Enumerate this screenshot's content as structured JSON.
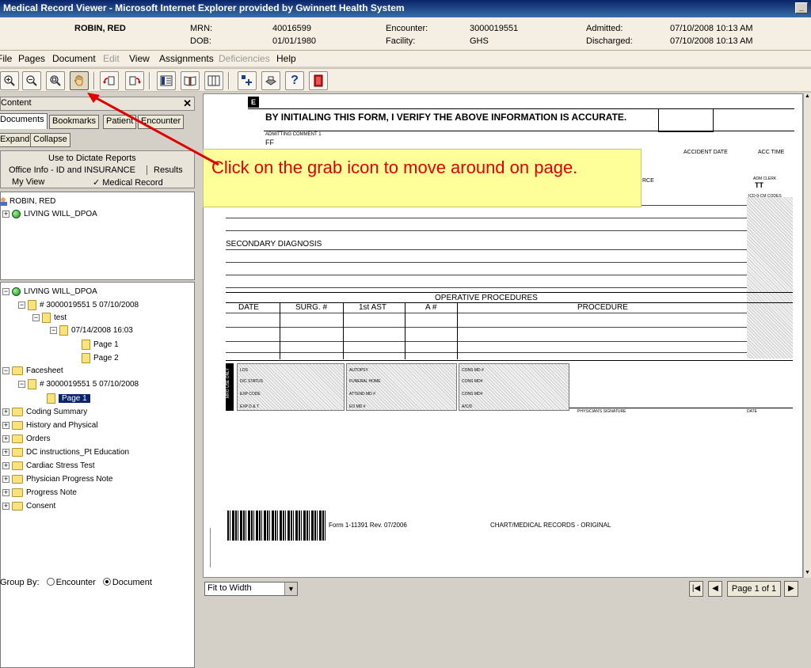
{
  "window": {
    "title": "Medical Record Viewer - Microsoft Internet Explorer provided by Gwinnett Health System"
  },
  "patient": {
    "name": "ROBIN, RED",
    "mrn_label": "MRN:",
    "mrn": "40016599",
    "dob_label": "DOB:",
    "dob": "01/01/1980",
    "encounter_label": "Encounter:",
    "encounter": "3000019551",
    "facility_label": "Facility:",
    "facility": "GHS",
    "admitted_label": "Admitted:",
    "admitted": "07/10/2008 10:13 AM",
    "discharged_label": "Discharged:",
    "discharged": "07/10/2008 10:13 AM"
  },
  "menu": {
    "file": "File",
    "pages": "Pages",
    "document": "Document",
    "edit": "Edit",
    "view": "View",
    "assignments": "Assignments",
    "deficiencies": "Deficiencies",
    "help": "Help"
  },
  "toolbar": {
    "icons": [
      "zoom-in-icon",
      "zoom-out-icon",
      "zoom-area-icon",
      "grab-hand-icon",
      "rotate-left-icon",
      "rotate-right-icon",
      "thumbnails-icon",
      "book-icon",
      "columns-icon",
      "add-page-icon",
      "print-icon",
      "help-icon",
      "exit-icon"
    ]
  },
  "content_panel": {
    "title": "Content",
    "close": "✕",
    "tabs": [
      "Documents",
      "Bookmarks",
      "Patient",
      "Encounter"
    ],
    "expand": "Expand",
    "collapse": "Collapse",
    "dictate": "Use to Dictate Reports",
    "office_info": "Office Info - ID and INSURANCE",
    "results": "Results",
    "my_view": "My View",
    "medical_record": "✓ Medical Record"
  },
  "patient_tree": {
    "patient": "ROBIN, RED",
    "living_will": "LIVING WILL_DPOA"
  },
  "doc_tree": {
    "living_will": "LIVING WILL_DPOA",
    "enc1": "# 3000019551  5  07/10/2008",
    "test": "test",
    "test_date": "07/14/2008 16:03",
    "page1": "Page 1",
    "page2": "Page 2",
    "facesheet": "Facesheet",
    "enc2": "# 3000019551  5  07/10/2008",
    "page1_sel": "Page 1",
    "folders": [
      "Coding Summary",
      "History and Physical",
      "Orders",
      "DC instructions_Pt Education",
      "Cardiac Stress Test",
      "Physician Progress Note",
      "Progress Note",
      "Consent"
    ]
  },
  "group_by": {
    "label": "Group By:",
    "encounter": "Encounter",
    "document": "Document"
  },
  "document": {
    "section_letter": "E",
    "verify_text": "BY INITIALING THIS FORM, I VERIFY THE ABOVE INFORMATION IS ACCURATE.",
    "admitting_comment": "ADMITTING COMMENT 1",
    "comment_value": "FF",
    "accident_date": "ACCIDENT DATE",
    "acc_time": "ACC TIME",
    "source": "RCE",
    "adm_clerk": "ADM CLERK",
    "clerk_value": "TT",
    "icd": "ICD-9-CM CODES",
    "secondary_diagnosis": "SECONDARY DIAGNOSIS",
    "operative_procedures": "OPERATIVE PROCEDURES",
    "col_date": "DATE",
    "col_surg": "SURG. #",
    "col_ast": "1st AST",
    "col_a": "A #",
    "col_procedure": "PROCEDURE",
    "mro_use_only": "MRO USE ONLY",
    "los": "LOS",
    "dc_status": "D/C STATUS",
    "exp_code": "EXP CODE",
    "exp_dt": "EXP D & T",
    "autopsy": "AUTOPSY",
    "funeral_home": "FUNERAL HOME",
    "attend_md": "ATTEND MD #",
    "eo_md": "EO MD #",
    "cons_md1": "CONS MD #",
    "cons_md2": "CONS MD#",
    "cons_md3": "CONS MD#",
    "acd": "A/C/D",
    "physician_signature": "PHYSICIAN'S SIGNATURE",
    "sig_date": "DATE",
    "form_number": "Form 1-11391 Rev. 07/2006",
    "footer": "CHART/MEDICAL RECORDS - ORIGINAL"
  },
  "callout": {
    "text": "Click on the grab icon to move around on page.",
    "color": "#e00000",
    "background": "#ffff99"
  },
  "statusbar": {
    "zoom": "Fit to Width",
    "page_indicator": "Page 1 of 1"
  }
}
